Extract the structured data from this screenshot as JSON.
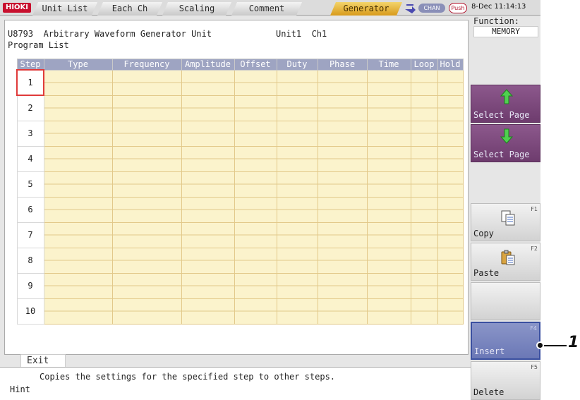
{
  "topbar": {
    "logo": "HIOKI",
    "tabs": [
      {
        "label": "Unit List",
        "active": false
      },
      {
        "label": "Each Ch",
        "active": false
      },
      {
        "label": "Scaling",
        "active": false
      },
      {
        "label": "Comment",
        "active": false
      },
      {
        "label": "Generator",
        "active": true
      }
    ],
    "chan_badge": "CHAN",
    "push_badge": "Push",
    "datetime": "8-Dec 11:14:13"
  },
  "header": {
    "title": "U8793  Arbitrary Waveform Generator Unit",
    "unit": "Unit1  Ch1",
    "list_title": "Program List"
  },
  "table": {
    "columns": [
      "Step",
      "Type",
      "Frequency",
      "Amplitude",
      "Offset",
      "Duty",
      "Phase",
      "Time",
      "Loop",
      "Hold"
    ],
    "steps": [
      "1",
      "2",
      "3",
      "4",
      "5",
      "6",
      "7",
      "8",
      "9",
      "10"
    ],
    "selected_step": "1"
  },
  "exit_label": "Exit",
  "hint": {
    "label": "Hint",
    "text": "Copies the settings for the specified step to other steps."
  },
  "side": {
    "function_label": "Function:",
    "function_value": "MEMORY",
    "buttons": [
      {
        "label": "Select Page",
        "icon": "arrow-up-icon",
        "key": ""
      },
      {
        "label": "Select Page",
        "icon": "arrow-down-icon",
        "key": ""
      },
      {
        "label": "Copy",
        "icon": "copy-icon",
        "key": "F1"
      },
      {
        "label": "Paste",
        "icon": "paste-icon",
        "key": "F2"
      },
      {
        "label": "Insert",
        "icon": "",
        "key": "F4"
      },
      {
        "label": "Delete",
        "icon": "",
        "key": "F5"
      }
    ]
  },
  "callout": "1",
  "colors": {
    "header_bg": "#9ea4c2",
    "cell_bg": "#fbf3cc",
    "purple_button": "#7a467a",
    "insert_button": "#7b86c0",
    "active_tab": "#e8b93a",
    "selection": "#e03a3a"
  }
}
